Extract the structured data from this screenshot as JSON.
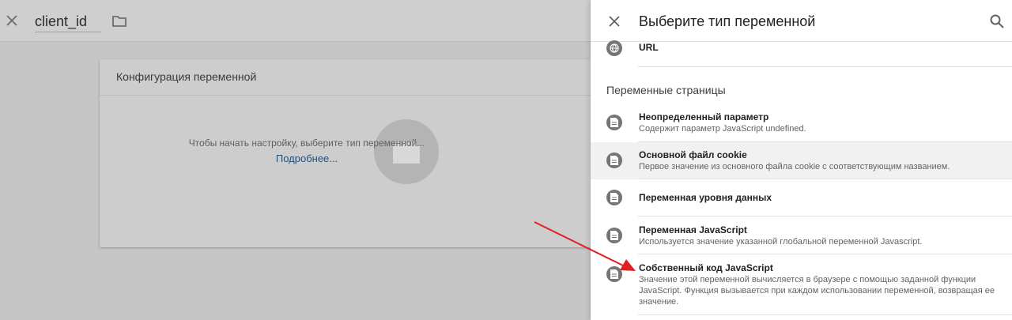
{
  "editor": {
    "variable_name": "client_id",
    "config_title": "Конфигурация переменной",
    "hint": "Чтобы начать настройку, выберите тип переменной...",
    "learn_more": "Подробнее..."
  },
  "panel": {
    "title": "Выберите тип переменной",
    "url_item": "URL",
    "section_title": "Переменные страницы",
    "items": [
      {
        "title": "Неопределенный параметр",
        "desc": "Содержит параметр JavaScript undefined."
      },
      {
        "title": "Основной файл cookie",
        "desc": "Первое значение из основного файла cookie с соответствующим названием."
      },
      {
        "title": "Переменная уровня данных",
        "desc": ""
      },
      {
        "title": "Переменная JavaScript",
        "desc": "Используется значение указанной глобальной переменной Javascript."
      },
      {
        "title": "Собственный код JavaScript",
        "desc": "Значение этой переменной вычисляется в браузере с помощью заданной функции JavaScript. Функция вызывается при каждом использовании переменной, возвращая ее значение."
      }
    ]
  },
  "icons": {
    "close": "close-icon",
    "folder": "folder-icon",
    "search": "search-icon",
    "globe": "globe-icon",
    "document": "document-icon",
    "brick": "brick-icon"
  },
  "colors": {
    "link": "#23527a",
    "arrow": "#e02020",
    "icon_circle": "#757575",
    "hover_row": "#f1f1f1"
  }
}
